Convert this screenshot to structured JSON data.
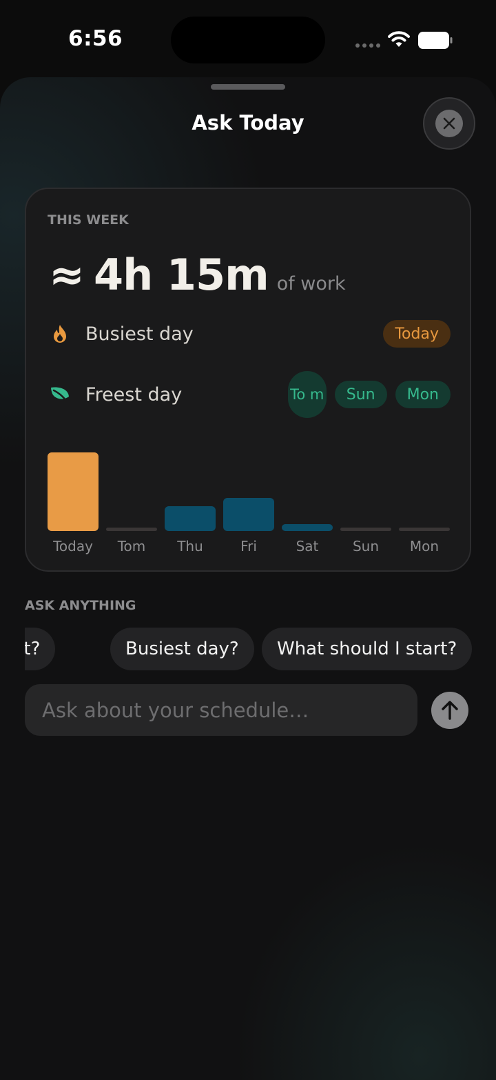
{
  "status_bar": {
    "time": "6:56"
  },
  "sheet": {
    "title": "Ask Today"
  },
  "week_card": {
    "label": "THIS WEEK",
    "approx_symbol": "≈",
    "work_total": "4h 15m",
    "work_suffix": "of work",
    "busiest": {
      "label": "Busiest day",
      "days": [
        "Today"
      ]
    },
    "freest": {
      "label": "Freest day",
      "days": [
        "To m",
        "Sun",
        "Mon"
      ]
    }
  },
  "chart_data": {
    "type": "bar",
    "categories": [
      "Today",
      "Tom",
      "Thu",
      "Fri",
      "Sat",
      "Sun",
      "Mon"
    ],
    "values": [
      1.9,
      0,
      0.6,
      0.8,
      0.17,
      0,
      0
    ],
    "colors": [
      "#e89b46",
      "#3a3636",
      "#0b4e69",
      "#0b4e69",
      "#0b4e69",
      "#3a3636",
      "#3a3636"
    ]
  },
  "ask": {
    "label": "ASK ANYTHING",
    "suggestions": [
      "Which day is freest?",
      "Busiest day?",
      "What should I start?"
    ],
    "input_placeholder": "Ask about your schedule…"
  },
  "colors": {
    "accent_orange": "#e8993f",
    "accent_green": "#36b98d",
    "bar_blue": "#0b4e69"
  }
}
